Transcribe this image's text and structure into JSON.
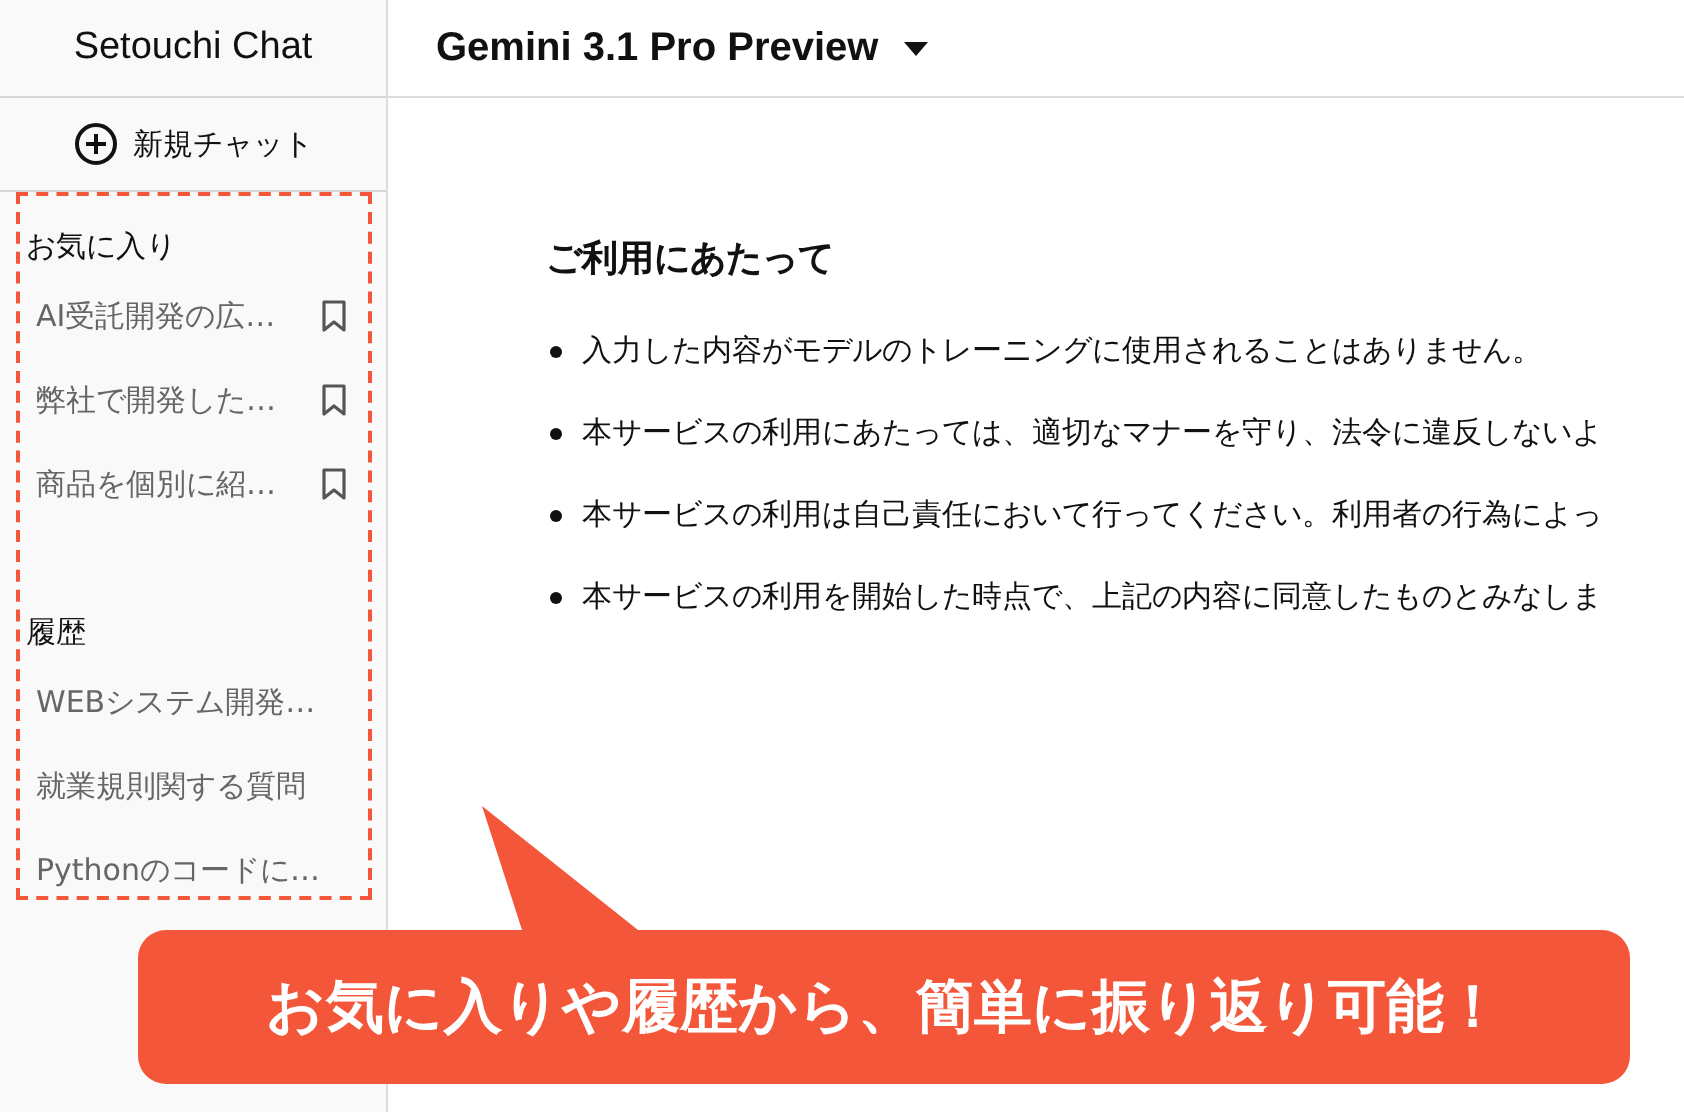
{
  "sidebar": {
    "app_title": "Setouchi Chat",
    "new_chat": "新規チャット",
    "favorites": {
      "heading": "お気に入り",
      "items": [
        {
          "label": "AI受託開発の広…"
        },
        {
          "label": "弊社で開発した…"
        },
        {
          "label": "商品を個別に紹…"
        }
      ]
    },
    "history": {
      "heading": "履歴",
      "items": [
        {
          "label": "WEBシステム開発…"
        },
        {
          "label": "就業規則関する質問"
        },
        {
          "label": "Pythonのコードに…"
        }
      ]
    }
  },
  "header": {
    "model": "Gemini 3.1 Pro Preview"
  },
  "notice": {
    "heading": "ご利用にあたって",
    "items": [
      "入力した内容がモデルのトレーニングに使用されることはありません。",
      "本サービスの利用にあたっては、適切なマナーを守り、法令に違反しないよ",
      "本サービスの利用は自己責任において行ってください。利用者の行為によっ",
      "本サービスの利用を開始した時点で、上記の内容に同意したものとみなしま"
    ]
  },
  "callout": {
    "text": "お気に入りや履歴から、簡単に振り返り可能！"
  }
}
